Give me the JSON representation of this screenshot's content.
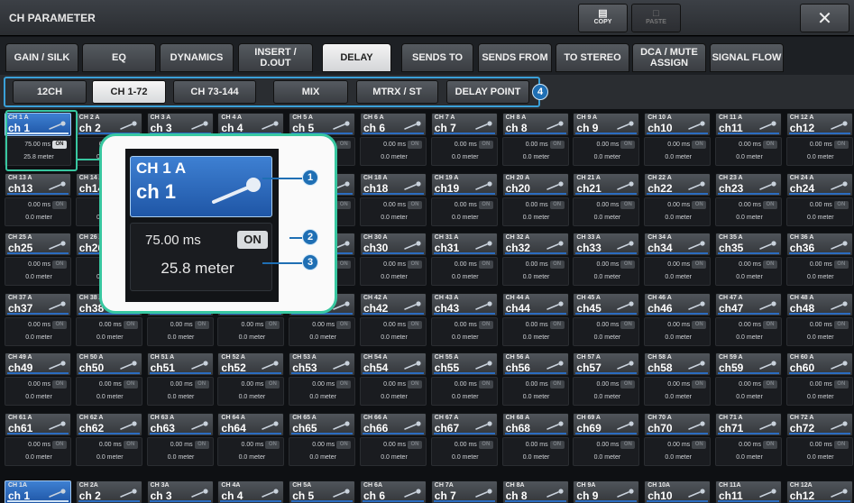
{
  "window": {
    "title": "CH PARAMETER",
    "copy_label": "COPY",
    "paste_label": "PASTE",
    "close_label": "✕"
  },
  "tabs": [
    {
      "label": "GAIN / SILK"
    },
    {
      "label": "EQ"
    },
    {
      "label": "DYNAMICS"
    },
    {
      "label": "INSERT / D.OUT"
    },
    {
      "label": "DELAY"
    },
    {
      "label": "SENDS TO"
    },
    {
      "label": "SENDS FROM"
    },
    {
      "label": "TO STEREO"
    },
    {
      "label": "DCA / MUTE ASSIGN"
    },
    {
      "label": "SIGNAL FLOW"
    }
  ],
  "active_tab": "DELAY",
  "channel_ranges": [
    {
      "label": "12CH"
    },
    {
      "label": "CH 1-72"
    },
    {
      "label": "CH 73-144"
    },
    {
      "label": "MIX"
    },
    {
      "label": "MTRX / ST"
    },
    {
      "label": "DELAY POINT"
    }
  ],
  "active_range": "CH 1-72",
  "callouts": [
    "1",
    "2",
    "3",
    "4"
  ],
  "zoom": {
    "id": "CH 1 A",
    "name": "ch 1",
    "delay": "75.00 ms",
    "on": "ON",
    "meter": "25.8 meter"
  },
  "channels": [
    {
      "id": "CH 1 A",
      "name": "ch 1",
      "delay": "75.00 ms",
      "on": "ON",
      "meter": "25.8 meter",
      "on_lit": true,
      "selected": true
    },
    {
      "id": "CH 2 A",
      "name": "ch 2",
      "delay": "0.00 ms",
      "on": "ON",
      "meter": "0.0 meter"
    },
    {
      "id": "CH 3 A",
      "name": "ch 3",
      "delay": "0.00 ms",
      "on": "ON",
      "meter": "0.0 meter"
    },
    {
      "id": "CH 4 A",
      "name": "ch 4",
      "delay": "0.00 ms",
      "on": "ON",
      "meter": "0.0 meter"
    },
    {
      "id": "CH 5 A",
      "name": "ch 5",
      "delay": "0.00 ms",
      "on": "ON",
      "meter": "0.0 meter"
    },
    {
      "id": "CH 6 A",
      "name": "ch 6",
      "delay": "0.00 ms",
      "on": "ON",
      "meter": "0.0 meter"
    },
    {
      "id": "CH 7 A",
      "name": "ch 7",
      "delay": "0.00 ms",
      "on": "ON",
      "meter": "0.0 meter"
    },
    {
      "id": "CH 8 A",
      "name": "ch 8",
      "delay": "0.00 ms",
      "on": "ON",
      "meter": "0.0 meter"
    },
    {
      "id": "CH 9 A",
      "name": "ch 9",
      "delay": "0.00 ms",
      "on": "ON",
      "meter": "0.0 meter"
    },
    {
      "id": "CH 10 A",
      "name": "ch10",
      "delay": "0.00 ms",
      "on": "ON",
      "meter": "0.0 meter"
    },
    {
      "id": "CH 11 A",
      "name": "ch11",
      "delay": "0.00 ms",
      "on": "ON",
      "meter": "0.0 meter"
    },
    {
      "id": "CH 12 A",
      "name": "ch12",
      "delay": "0.00 ms",
      "on": "ON",
      "meter": "0.0 meter"
    },
    {
      "id": "CH 13 A",
      "name": "ch13",
      "delay": "0.00 ms",
      "on": "ON",
      "meter": "0.0 meter"
    },
    {
      "id": "CH 14 A",
      "name": "ch14",
      "delay": "0.00 ms",
      "on": "ON",
      "meter": "0.0 meter"
    },
    {
      "id": "CH 15 A",
      "name": "ch15",
      "delay": "0.00 ms",
      "on": "ON",
      "meter": "0.0 meter"
    },
    {
      "id": "CH 16 A",
      "name": "ch16",
      "delay": "0.00 ms",
      "on": "ON",
      "meter": "0.0 meter"
    },
    {
      "id": "CH 17 A",
      "name": "ch17",
      "delay": "0.00 ms",
      "on": "ON",
      "meter": "0.0 meter"
    },
    {
      "id": "CH 18 A",
      "name": "ch18",
      "delay": "0.00 ms",
      "on": "ON",
      "meter": "0.0 meter"
    },
    {
      "id": "CH 19 A",
      "name": "ch19",
      "delay": "0.00 ms",
      "on": "ON",
      "meter": "0.0 meter"
    },
    {
      "id": "CH 20 A",
      "name": "ch20",
      "delay": "0.00 ms",
      "on": "ON",
      "meter": "0.0 meter"
    },
    {
      "id": "CH 21 A",
      "name": "ch21",
      "delay": "0.00 ms",
      "on": "ON",
      "meter": "0.0 meter"
    },
    {
      "id": "CH 22 A",
      "name": "ch22",
      "delay": "0.00 ms",
      "on": "ON",
      "meter": "0.0 meter"
    },
    {
      "id": "CH 23 A",
      "name": "ch23",
      "delay": "0.00 ms",
      "on": "ON",
      "meter": "0.0 meter"
    },
    {
      "id": "CH 24 A",
      "name": "ch24",
      "delay": "0.00 ms",
      "on": "ON",
      "meter": "0.0 meter"
    },
    {
      "id": "CH 25 A",
      "name": "ch25",
      "delay": "0.00 ms",
      "on": "ON",
      "meter": "0.0 meter"
    },
    {
      "id": "CH 26 A",
      "name": "ch26",
      "delay": "0.00 ms",
      "on": "ON",
      "meter": "0.0 meter"
    },
    {
      "id": "CH 27 A",
      "name": "ch27",
      "delay": "0.00 ms",
      "on": "ON",
      "meter": "0.0 meter"
    },
    {
      "id": "CH 28 A",
      "name": "ch28",
      "delay": "0.00 ms",
      "on": "ON",
      "meter": "0.0 meter"
    },
    {
      "id": "CH 29 A",
      "name": "ch29",
      "delay": "0.00 ms",
      "on": "ON",
      "meter": "0.0 meter"
    },
    {
      "id": "CH 30 A",
      "name": "ch30",
      "delay": "0.00 ms",
      "on": "ON",
      "meter": "0.0 meter"
    },
    {
      "id": "CH 31 A",
      "name": "ch31",
      "delay": "0.00 ms",
      "on": "ON",
      "meter": "0.0 meter"
    },
    {
      "id": "CH 32 A",
      "name": "ch32",
      "delay": "0.00 ms",
      "on": "ON",
      "meter": "0.0 meter"
    },
    {
      "id": "CH 33 A",
      "name": "ch33",
      "delay": "0.00 ms",
      "on": "ON",
      "meter": "0.0 meter"
    },
    {
      "id": "CH 34 A",
      "name": "ch34",
      "delay": "0.00 ms",
      "on": "ON",
      "meter": "0.0 meter"
    },
    {
      "id": "CH 35 A",
      "name": "ch35",
      "delay": "0.00 ms",
      "on": "ON",
      "meter": "0.0 meter"
    },
    {
      "id": "CH 36 A",
      "name": "ch36",
      "delay": "0.00 ms",
      "on": "ON",
      "meter": "0.0 meter"
    },
    {
      "id": "CH 37 A",
      "name": "ch37",
      "delay": "0.00 ms",
      "on": "ON",
      "meter": "0.0 meter"
    },
    {
      "id": "CH 38 A",
      "name": "ch38",
      "delay": "0.00 ms",
      "on": "ON",
      "meter": "0.0 meter"
    },
    {
      "id": "CH 39 A",
      "name": "ch39",
      "delay": "0.00 ms",
      "on": "ON",
      "meter": "0.0 meter"
    },
    {
      "id": "CH 40 A",
      "name": "ch40",
      "delay": "0.00 ms",
      "on": "ON",
      "meter": "0.0 meter"
    },
    {
      "id": "CH 41 A",
      "name": "ch41",
      "delay": "0.00 ms",
      "on": "ON",
      "meter": "0.0 meter"
    },
    {
      "id": "CH 42 A",
      "name": "ch42",
      "delay": "0.00 ms",
      "on": "ON",
      "meter": "0.0 meter"
    },
    {
      "id": "CH 43 A",
      "name": "ch43",
      "delay": "0.00 ms",
      "on": "ON",
      "meter": "0.0 meter"
    },
    {
      "id": "CH 44 A",
      "name": "ch44",
      "delay": "0.00 ms",
      "on": "ON",
      "meter": "0.0 meter"
    },
    {
      "id": "CH 45 A",
      "name": "ch45",
      "delay": "0.00 ms",
      "on": "ON",
      "meter": "0.0 meter"
    },
    {
      "id": "CH 46 A",
      "name": "ch46",
      "delay": "0.00 ms",
      "on": "ON",
      "meter": "0.0 meter"
    },
    {
      "id": "CH 47 A",
      "name": "ch47",
      "delay": "0.00 ms",
      "on": "ON",
      "meter": "0.0 meter"
    },
    {
      "id": "CH 48 A",
      "name": "ch48",
      "delay": "0.00 ms",
      "on": "ON",
      "meter": "0.0 meter"
    },
    {
      "id": "CH 49 A",
      "name": "ch49",
      "delay": "0.00 ms",
      "on": "ON",
      "meter": "0.0 meter"
    },
    {
      "id": "CH 50 A",
      "name": "ch50",
      "delay": "0.00 ms",
      "on": "ON",
      "meter": "0.0 meter"
    },
    {
      "id": "CH 51 A",
      "name": "ch51",
      "delay": "0.00 ms",
      "on": "ON",
      "meter": "0.0 meter"
    },
    {
      "id": "CH 52 A",
      "name": "ch52",
      "delay": "0.00 ms",
      "on": "ON",
      "meter": "0.0 meter"
    },
    {
      "id": "CH 53 A",
      "name": "ch53",
      "delay": "0.00 ms",
      "on": "ON",
      "meter": "0.0 meter"
    },
    {
      "id": "CH 54 A",
      "name": "ch54",
      "delay": "0.00 ms",
      "on": "ON",
      "meter": "0.0 meter"
    },
    {
      "id": "CH 55 A",
      "name": "ch55",
      "delay": "0.00 ms",
      "on": "ON",
      "meter": "0.0 meter"
    },
    {
      "id": "CH 56 A",
      "name": "ch56",
      "delay": "0.00 ms",
      "on": "ON",
      "meter": "0.0 meter"
    },
    {
      "id": "CH 57 A",
      "name": "ch57",
      "delay": "0.00 ms",
      "on": "ON",
      "meter": "0.0 meter"
    },
    {
      "id": "CH 58 A",
      "name": "ch58",
      "delay": "0.00 ms",
      "on": "ON",
      "meter": "0.0 meter"
    },
    {
      "id": "CH 59 A",
      "name": "ch59",
      "delay": "0.00 ms",
      "on": "ON",
      "meter": "0.0 meter"
    },
    {
      "id": "CH 60 A",
      "name": "ch60",
      "delay": "0.00 ms",
      "on": "ON",
      "meter": "0.0 meter"
    },
    {
      "id": "CH 61 A",
      "name": "ch61",
      "delay": "0.00 ms",
      "on": "ON",
      "meter": "0.0 meter"
    },
    {
      "id": "CH 62 A",
      "name": "ch62",
      "delay": "0.00 ms",
      "on": "ON",
      "meter": "0.0 meter"
    },
    {
      "id": "CH 63 A",
      "name": "ch63",
      "delay": "0.00 ms",
      "on": "ON",
      "meter": "0.0 meter"
    },
    {
      "id": "CH 64 A",
      "name": "ch64",
      "delay": "0.00 ms",
      "on": "ON",
      "meter": "0.0 meter"
    },
    {
      "id": "CH 65 A",
      "name": "ch65",
      "delay": "0.00 ms",
      "on": "ON",
      "meter": "0.0 meter"
    },
    {
      "id": "CH 66 A",
      "name": "ch66",
      "delay": "0.00 ms",
      "on": "ON",
      "meter": "0.0 meter"
    },
    {
      "id": "CH 67 A",
      "name": "ch67",
      "delay": "0.00 ms",
      "on": "ON",
      "meter": "0.0 meter"
    },
    {
      "id": "CH 68 A",
      "name": "ch68",
      "delay": "0.00 ms",
      "on": "ON",
      "meter": "0.0 meter"
    },
    {
      "id": "CH 69 A",
      "name": "ch69",
      "delay": "0.00 ms",
      "on": "ON",
      "meter": "0.0 meter"
    },
    {
      "id": "CH 70 A",
      "name": "ch70",
      "delay": "0.00 ms",
      "on": "ON",
      "meter": "0.0 meter"
    },
    {
      "id": "CH 71 A",
      "name": "ch71",
      "delay": "0.00 ms",
      "on": "ON",
      "meter": "0.0 meter"
    },
    {
      "id": "CH 72 A",
      "name": "ch72",
      "delay": "0.00 ms",
      "on": "ON",
      "meter": "0.0 meter"
    }
  ],
  "bottom_row": [
    {
      "id": "CH 1A",
      "name": "ch 1",
      "selected": true
    },
    {
      "id": "CH 2A",
      "name": "ch 2"
    },
    {
      "id": "CH 3A",
      "name": "ch 3"
    },
    {
      "id": "CH 4A",
      "name": "ch 4"
    },
    {
      "id": "CH 5A",
      "name": "ch 5"
    },
    {
      "id": "CH 6A",
      "name": "ch 6"
    },
    {
      "id": "CH 7A",
      "name": "ch 7"
    },
    {
      "id": "CH 8A",
      "name": "ch 8"
    },
    {
      "id": "CH 9A",
      "name": "ch 9"
    },
    {
      "id": "CH 10A",
      "name": "ch10"
    },
    {
      "id": "CH 11A",
      "name": "ch11"
    },
    {
      "id": "CH 12A",
      "name": "ch12"
    }
  ],
  "colors": {
    "accent": "#2b6cc0",
    "selected": "#1f56a6",
    "callout": "#38c7a0",
    "badge": "#1f6fb4"
  }
}
